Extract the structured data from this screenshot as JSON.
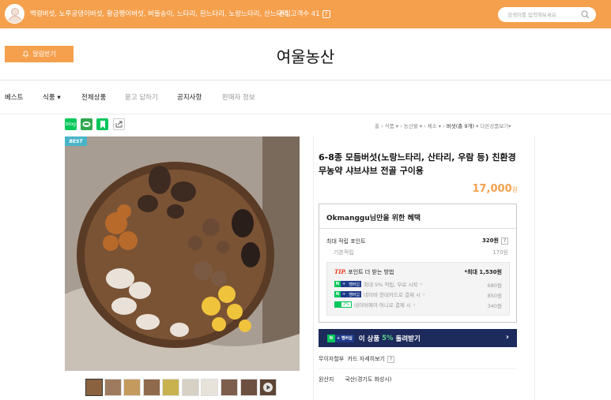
{
  "topbar": {
    "keywords": "백령버섯, 노루궁뎅이버섯, 황금팽이버섯, 버들송이, 느타리, 흰느타리, 노랑느타리, 산느타리",
    "interest_label": "관심고객수 41",
    "interest_help": "?",
    "search_placeholder": "검색어를 입력해보세요",
    "color": "#f5a04d"
  },
  "alarm_label": "알림받기",
  "store_name": "여울농산",
  "nav": [
    "베스트",
    "식품",
    "전체상품",
    "묻고 답하기",
    "공지사항",
    "판매자 정보"
  ],
  "share": {
    "blog_label": "blog",
    "icons": [
      "blog-icon",
      "talk-icon",
      "bookmark-icon",
      "share-icon"
    ]
  },
  "breadcrumb": {
    "items": [
      "홈",
      "식품",
      "농산물",
      "채소",
      "버섯(총 9개)"
    ],
    "more": "다른상품보기"
  },
  "product": {
    "badge": "BEST",
    "title": "6-8종 모듬버섯(노랑느타리, 산타리, 우람 등) 친환경 무농약 샤브샤브 전골 구이용",
    "price": "17,000",
    "price_unit": "원"
  },
  "benefit": {
    "title": "Okmanggu님만을 위한 혜택",
    "max_points_label": "최대 적립 포인트",
    "max_points_value": "320원",
    "basic_label": "기본적립",
    "basic_value": "170원",
    "tip_prefix": "TIP.",
    "tip_label": "포인트 더 받는 방법",
    "tip_max": "*최대 1,530원",
    "tip_rows": [
      {
        "badge": "멤버십",
        "text": "최대 5% 적립, 무료 시작",
        "value": "680원"
      },
      {
        "badge": "멤버십",
        "text": "네이버 현대카드로 결제 시",
        "value": "850원"
      },
      {
        "badge": "2%",
        "text": "네이버페이 머니로 결제 시",
        "value": "340원"
      }
    ]
  },
  "banner": {
    "prefix": "이 상품",
    "pct": "5%",
    "suffix": "돌려받기",
    "chevron": "›"
  },
  "interest_free": {
    "label": "무이자할부",
    "link": "카드 자세히보기",
    "help": "?"
  },
  "origin": {
    "label": "원산지",
    "value": "국산(경기도 화성시)"
  }
}
